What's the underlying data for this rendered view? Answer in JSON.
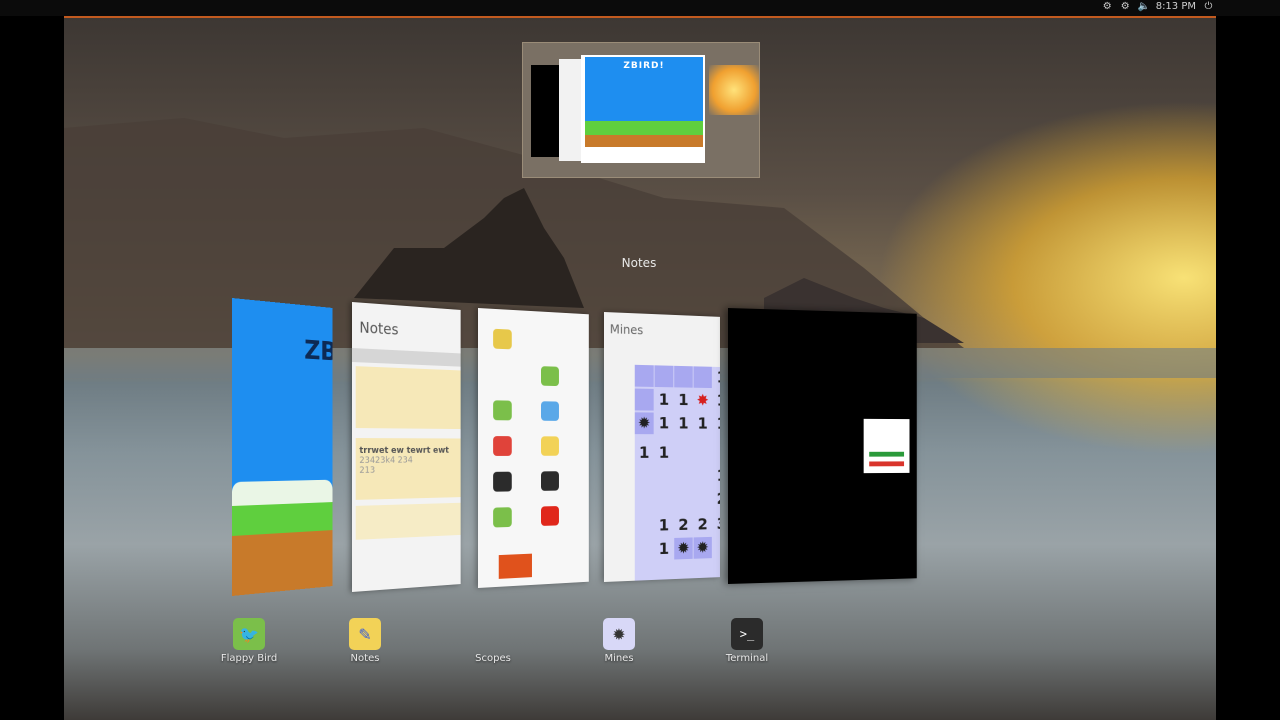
{
  "topbar": {
    "time": "8:13 PM",
    "icons": [
      "settings-icon",
      "network-icon",
      "volume-icon",
      "power-icon"
    ]
  },
  "spread": {
    "focused_label": "Notes"
  },
  "windows": {
    "flappy": {
      "title": "ZB"
    },
    "notes": {
      "header": "Notes",
      "note2_line1": "trrwet ew tewrt ewt",
      "note2_line2": "23423k4 234",
      "note2_line3": "213"
    },
    "mines": {
      "header": "Mines"
    }
  },
  "dock": {
    "items": [
      {
        "label": "Flappy Bird",
        "icon": "bird-icon",
        "color": "#7bbf4a"
      },
      {
        "label": "Notes",
        "icon": "pencil-icon",
        "color": "#f2d257"
      },
      {
        "label": "Scopes",
        "icon": "",
        "color": ""
      },
      {
        "label": "Mines",
        "icon": "mine-icon",
        "color": "#d8d8f7"
      },
      {
        "label": "Terminal",
        "icon": "terminal-icon",
        "color": "#2b2b2b"
      }
    ]
  }
}
